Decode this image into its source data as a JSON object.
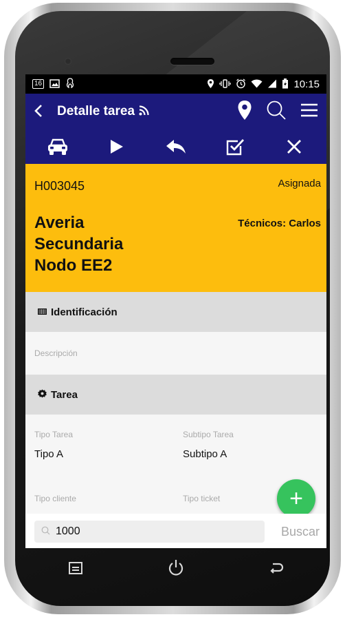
{
  "status_bar": {
    "badge": "16",
    "time": "10:15",
    "icons": [
      "image-icon",
      "notification-icon",
      "location-icon",
      "vibrate-icon",
      "alarm-icon",
      "wifi-icon",
      "signal-icon",
      "battery-icon"
    ]
  },
  "app_bar": {
    "title": "Detalle tarea",
    "title_icon": "rss-icon",
    "actions": [
      "location-pin-icon",
      "search-icon",
      "menu-icon"
    ],
    "background": "#1c1a7c"
  },
  "action_bar": {
    "actions": [
      "car-icon",
      "play-icon",
      "reply-icon",
      "check-square-icon",
      "close-icon"
    ]
  },
  "task": {
    "id": "H003045",
    "status": "Asignada",
    "title_lines": [
      "Averia",
      "Secundaria",
      "Nodo EE2"
    ],
    "technicians": "Técnicos: Carlos",
    "background": "#fdbd0d"
  },
  "sections": {
    "identificacion": {
      "label": "Identificación",
      "icon": "barcode-icon"
    },
    "descripcion_label": "Descripción",
    "tarea": {
      "label": "Tarea",
      "icon": "gear-icon"
    }
  },
  "fields": {
    "tipo_tarea": {
      "label": "Tipo Tarea",
      "value": "Tipo A"
    },
    "subtipo_tarea": {
      "label": "Subtipo Tarea",
      "value": "Subtipo A"
    },
    "tipo_cliente": {
      "label": "Tipo cliente"
    },
    "tipo_ticket": {
      "label": "Tipo ticket"
    }
  },
  "fab": {
    "label": "+",
    "color": "#36c35d"
  },
  "search": {
    "value": "1000",
    "button_label": "Buscar"
  },
  "nav_keys": [
    "recent-apps-icon",
    "power-icon",
    "back-icon"
  ]
}
